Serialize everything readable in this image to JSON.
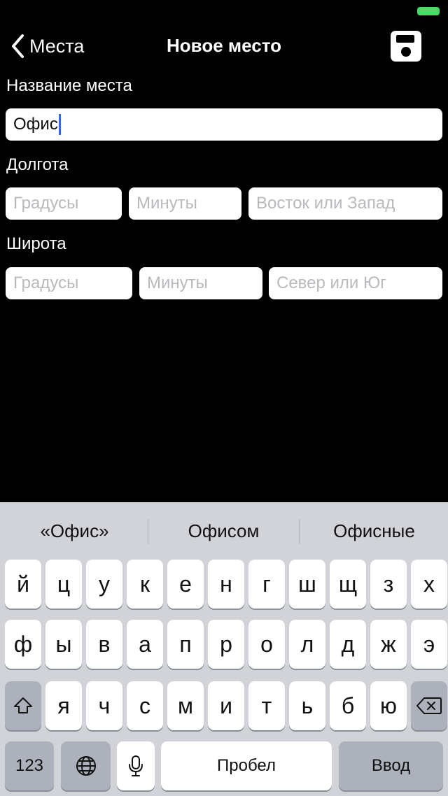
{
  "nav": {
    "back_label": "Места",
    "title": "Новое место"
  },
  "form": {
    "name_label": "Название места",
    "name_value": "Офис",
    "longitude_label": "Долгота",
    "longitude_degrees_placeholder": "Градусы",
    "longitude_minutes_placeholder": "Минуты",
    "longitude_dir_placeholder": "Восток или Запад",
    "latitude_label": "Широта",
    "latitude_degrees_placeholder": "Градусы",
    "latitude_minutes_placeholder": "Минуты",
    "latitude_dir_placeholder": "Север или Юг"
  },
  "keyboard": {
    "suggestions": [
      "«Офис»",
      "Офисом",
      "Офисные"
    ],
    "row1": [
      "й",
      "ц",
      "у",
      "к",
      "е",
      "н",
      "г",
      "ш",
      "щ",
      "з",
      "х"
    ],
    "row2": [
      "ф",
      "ы",
      "в",
      "а",
      "п",
      "р",
      "о",
      "л",
      "д",
      "ж",
      "э"
    ],
    "row3": [
      "я",
      "ч",
      "с",
      "м",
      "и",
      "т",
      "ь",
      "б",
      "ю"
    ],
    "numbers_label": "123",
    "space_label": "Пробел",
    "return_label": "Ввод"
  },
  "colors": {
    "background": "#000000",
    "battery": "#4cd964",
    "caret": "#2f6bde",
    "keyboard_bg": "#d1d3d9"
  }
}
